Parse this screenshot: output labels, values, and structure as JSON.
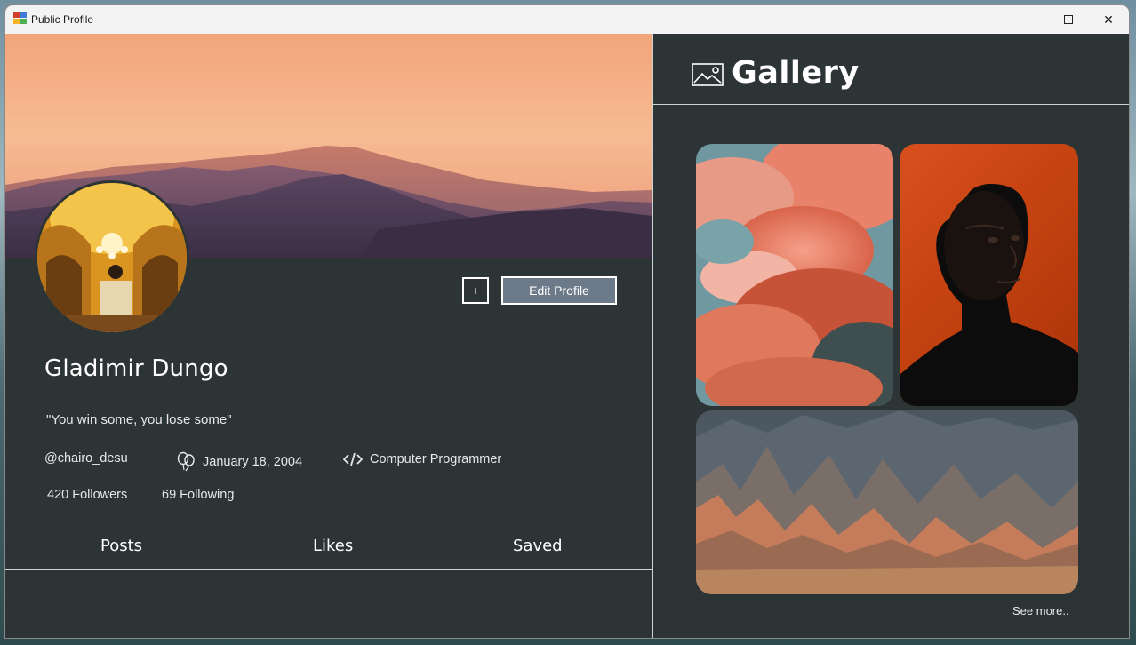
{
  "window": {
    "title": "Public Profile",
    "controls": {
      "minimize": "minimize",
      "maximize": "maximize",
      "close": "✕"
    }
  },
  "profile": {
    "name": "Gladimir Dungo",
    "bio": "\"You win some, you lose some\"",
    "handle": "@chairo_desu",
    "birthday": "January 18, 2004",
    "occupation": "Computer Programmer",
    "followers": "420 Followers",
    "following": "69 Following",
    "add_label": "+",
    "edit_label": "Edit Profile"
  },
  "tabs": [
    "Posts",
    "Likes",
    "Saved"
  ],
  "gallery": {
    "title": "Gallery",
    "see_more": "See more..",
    "images": [
      "clouds-photo",
      "portrait-photo",
      "mountains-photo"
    ]
  },
  "colors": {
    "background": "#2d3436",
    "edit_button": "#6c7a89",
    "text": "#ffffff"
  }
}
